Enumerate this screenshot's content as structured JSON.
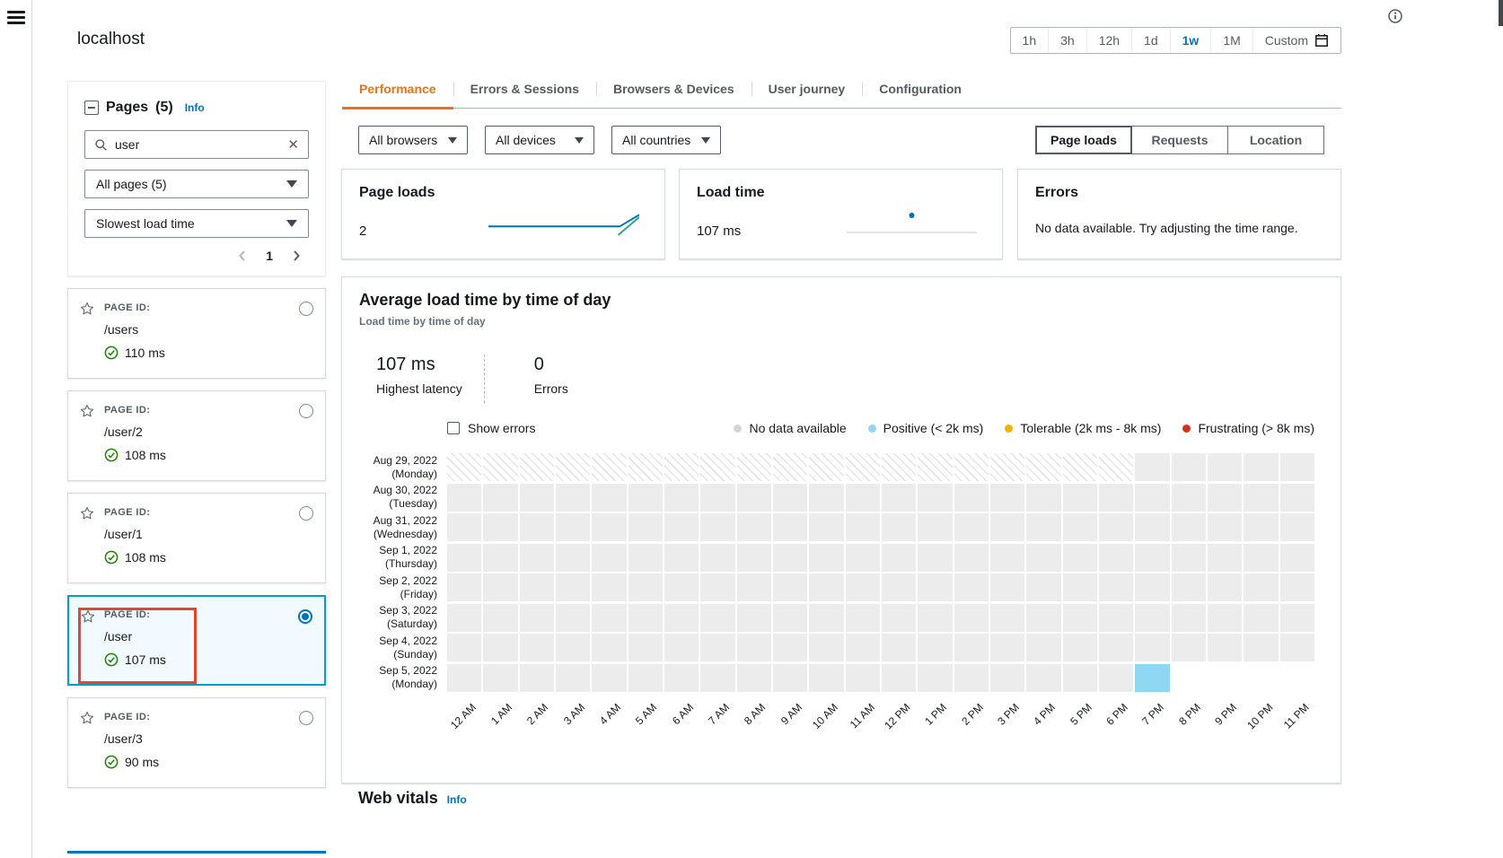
{
  "header": {
    "title": "localhost",
    "time_range": {
      "options": [
        "1h",
        "3h",
        "12h",
        "1d",
        "1w",
        "1M",
        "Custom"
      ],
      "selected": "1w"
    }
  },
  "sidebar": {
    "title": "Pages",
    "count": "(5)",
    "info_link": "Info",
    "search_value": "user",
    "page_filter": "All pages (5)",
    "sort_filter": "Slowest load time",
    "page_number": "1",
    "item_label": "PAGE ID:",
    "items": [
      {
        "id": "/users",
        "latency": "110 ms",
        "selected": false
      },
      {
        "id": "/user/2",
        "latency": "108 ms",
        "selected": false
      },
      {
        "id": "/user/1",
        "latency": "108 ms",
        "selected": false
      },
      {
        "id": "/user",
        "latency": "107 ms",
        "selected": true,
        "annotated": true
      },
      {
        "id": "/user/3",
        "latency": "90 ms",
        "selected": false
      }
    ]
  },
  "tabs": [
    {
      "label": "Performance",
      "active": true
    },
    {
      "label": "Errors & Sessions",
      "active": false
    },
    {
      "label": "Browsers & Devices",
      "active": false
    },
    {
      "label": "User journey",
      "active": false
    },
    {
      "label": "Configuration",
      "active": false
    }
  ],
  "filters": {
    "browsers": "All browsers",
    "devices": "All devices",
    "countries": "All countries"
  },
  "view_toggle": {
    "options": [
      "Page loads",
      "Requests",
      "Location"
    ],
    "selected": "Page loads"
  },
  "cards": {
    "page_loads": {
      "title": "Page loads",
      "value": "2"
    },
    "load_time": {
      "title": "Load time",
      "value": "107 ms"
    },
    "errors": {
      "title": "Errors",
      "message": "No data available. Try adjusting the time range."
    }
  },
  "panel": {
    "title": "Average load time by time of day",
    "subtitle": "Load time by time of day",
    "highest_latency_value": "107 ms",
    "highest_latency_label": "Highest latency",
    "errors_value": "0",
    "errors_label": "Errors",
    "show_errors_label": "Show errors",
    "legend": [
      {
        "label": "No data available",
        "color": "#d5d5d5"
      },
      {
        "label": "Positive (< 2k ms)",
        "color": "#8fd7f2"
      },
      {
        "label": "Tolerable (2k ms - 8k ms)",
        "color": "#f0b400"
      },
      {
        "label": "Frustrating (> 8k ms)",
        "color": "#d13212"
      }
    ]
  },
  "web_vitals": {
    "title": "Web vitals",
    "info_link": "Info"
  },
  "colors": {
    "accent_orange": "#ec7211",
    "link_blue": "#0073bb",
    "selected_item_bg": "#f1faff",
    "selected_item_border": "#00a1c9",
    "annotation_red": "#e8442d",
    "success_green": "#1d8102",
    "heatmap_gray": "#ececec",
    "heatmap_positive": "#8fd7f2"
  },
  "chart_data": [
    {
      "id": "page-loads-sparkline",
      "type": "line",
      "title": "Page loads",
      "summary_value": 2,
      "description": "Page-load count over the selected week: flat near zero, rising to 2 at the right end",
      "units": "normalized 0-1 (x across week, y=1 top of sparkline)",
      "series": [
        {
          "name": "page-loads",
          "color": "#0073bb",
          "points": [
            [
              0,
              0.45
            ],
            [
              0.87,
              0.45
            ],
            [
              1,
              0.95
            ]
          ]
        },
        {
          "name": "secondary-trend",
          "color": "#2ea597",
          "points": [
            [
              0.86,
              0.08
            ],
            [
              1,
              0.85
            ]
          ]
        }
      ]
    },
    {
      "id": "load-time-chart",
      "type": "scatter",
      "title": "Load time",
      "summary_value": "107 ms",
      "points": [
        {
          "x_norm": 0.5,
          "value_ms": 107
        }
      ],
      "baseline_color": "#d5dbdb",
      "dot_color": "#0073bb"
    },
    {
      "id": "load-time-heatmap",
      "type": "heatmap",
      "title": "Average load time by time of day",
      "x_labels": [
        "12 AM",
        "1 AM",
        "2 AM",
        "3 AM",
        "4 AM",
        "5 AM",
        "6 AM",
        "7 AM",
        "8 AM",
        "9 AM",
        "10 AM",
        "11 AM",
        "12 PM",
        "1 PM",
        "2 PM",
        "3 PM",
        "4 PM",
        "5 PM",
        "6 PM",
        "7 PM",
        "8 PM",
        "9 PM",
        "10 PM",
        "11 PM"
      ],
      "cell_key": {
        "H": "hatched - outside collection window",
        "G": "no data (gray)",
        "P": "positive (< 2k ms)",
        ".": "empty"
      },
      "cell_colors": {
        "G": "#ececec",
        "P": "#8fd7f2"
      },
      "rows": [
        {
          "date": "Aug 29, 2022",
          "day": "(Monday)",
          "cells": "HHHHHHHHHHHHHHHHHHHGGGGG"
        },
        {
          "date": "Aug 30, 2022",
          "day": "(Tuesday)",
          "cells": "GGGGGGGGGGGGGGGGGGGGGGGG"
        },
        {
          "date": "Aug 31, 2022",
          "day": "(Wednesday)",
          "cells": "GGGGGGGGGGGGGGGGGGGGGGGG"
        },
        {
          "date": "Sep 1, 2022",
          "day": "(Thursday)",
          "cells": "GGGGGGGGGGGGGGGGGGGGGGGG"
        },
        {
          "date": "Sep 2, 2022",
          "day": "(Friday)",
          "cells": "GGGGGGGGGGGGGGGGGGGGGGGG"
        },
        {
          "date": "Sep 3, 2022",
          "day": "(Saturday)",
          "cells": "GGGGGGGGGGGGGGGGGGGGGGGG"
        },
        {
          "date": "Sep 4, 2022",
          "day": "(Sunday)",
          "cells": "GGGGGGGGGGGGGGGGGGGGGGGG"
        },
        {
          "date": "Sep 5, 2022",
          "day": "(Monday)",
          "cells": "GGGGGGGGGGGGGGGGGGGP...."
        }
      ],
      "highlighted_cell": {
        "date": "Sep 5, 2022",
        "hour": "7 PM",
        "state": "positive"
      }
    }
  ]
}
